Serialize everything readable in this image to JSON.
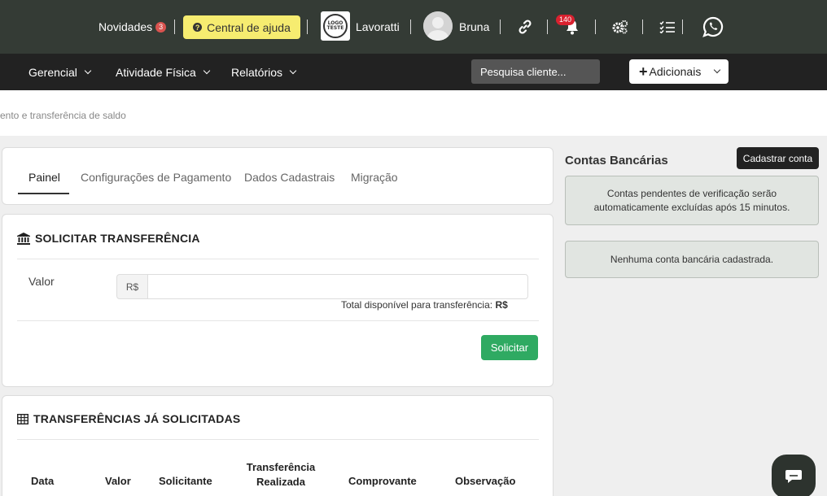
{
  "topbar": {
    "novidades_label": "Novidades",
    "novidades_count": "3",
    "help_label": "Central de ajuda",
    "logo_text": "LOGO TESTE",
    "company_name": "Lavoratti",
    "user_name": "Bruna",
    "notifications_count": "140",
    "icons": [
      "link-icon",
      "bell-icon",
      "gears-icon",
      "checklist-icon",
      "whatsapp-icon"
    ]
  },
  "nav": {
    "items": [
      {
        "label": "Gerencial"
      },
      {
        "label": "Atividade Física"
      },
      {
        "label": "Relatórios"
      }
    ],
    "search_placeholder": "Pesquisa cliente...",
    "adicionais_label": "Adicionais"
  },
  "breadcrumb": "ento e transferência de saldo",
  "tabs": [
    {
      "label": "Painel",
      "active": true
    },
    {
      "label": "Configurações de Pagamento"
    },
    {
      "label": "Dados Cadastrais"
    },
    {
      "label": "Migração"
    }
  ],
  "solicitar": {
    "title": "SOLICITAR TRANSFERÊNCIA",
    "valor_label": "Valor",
    "currency": "R$",
    "total_label": "Total disponível para transferência:",
    "total_value": "R$",
    "button_label": "Solicitar"
  },
  "transferencias": {
    "title": "TRANSFERÊNCIAS JÁ SOLICITADAS",
    "columns": [
      "Data",
      "Valor",
      "Solicitante",
      "Transferência Realizada",
      "Comprovante",
      "Observação"
    ]
  },
  "contas": {
    "title": "Contas Bancárias",
    "cadastrar_label": "Cadastrar conta",
    "pending_notice": "Contas pendentes de verificação serão automaticamente excluídas após 15 minutos.",
    "empty_notice": "Nenhuma conta bancária cadastrada."
  },
  "colors": {
    "topbar_bg": "#343b35",
    "navbar_bg": "#222222",
    "help_bg": "#f6ec70",
    "primary_green": "#2faa62",
    "badge_red": "#d9534f"
  }
}
